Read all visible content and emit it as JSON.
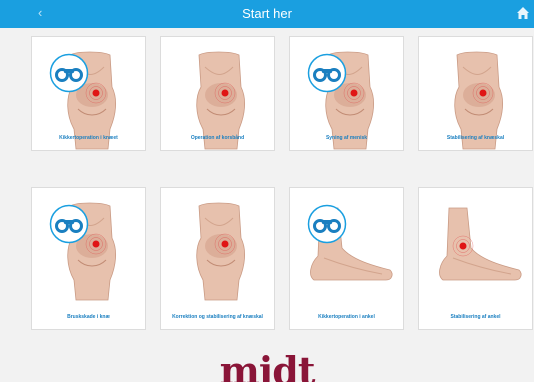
{
  "header": {
    "title": "Start her",
    "back_icon": "chevron-left-icon",
    "home_icon": "home-icon",
    "color": "#1a9fe0"
  },
  "cards": [
    {
      "label": "Kikkertoperation i knæet",
      "scope": true,
      "image": "knee"
    },
    {
      "label": "Operation af korsbånd",
      "scope": false,
      "image": "knee"
    },
    {
      "label": "Syning af menisk",
      "scope": true,
      "image": "knee"
    },
    {
      "label": "Stabilisering af knæskal",
      "scope": false,
      "image": "knee"
    },
    {
      "label": "Bruskskade i knæ",
      "scope": true,
      "image": "knee"
    },
    {
      "label": "Korrektion og stabilisering af knæskal",
      "scope": false,
      "image": "knee"
    },
    {
      "label": "Kikkertoperation i ankel",
      "scope": true,
      "image": "foot"
    },
    {
      "label": "Stabilisering af ankel",
      "scope": false,
      "image": "foot"
    }
  ],
  "footer": {
    "logo_text": "midt",
    "logo_color": "#8a1538"
  }
}
